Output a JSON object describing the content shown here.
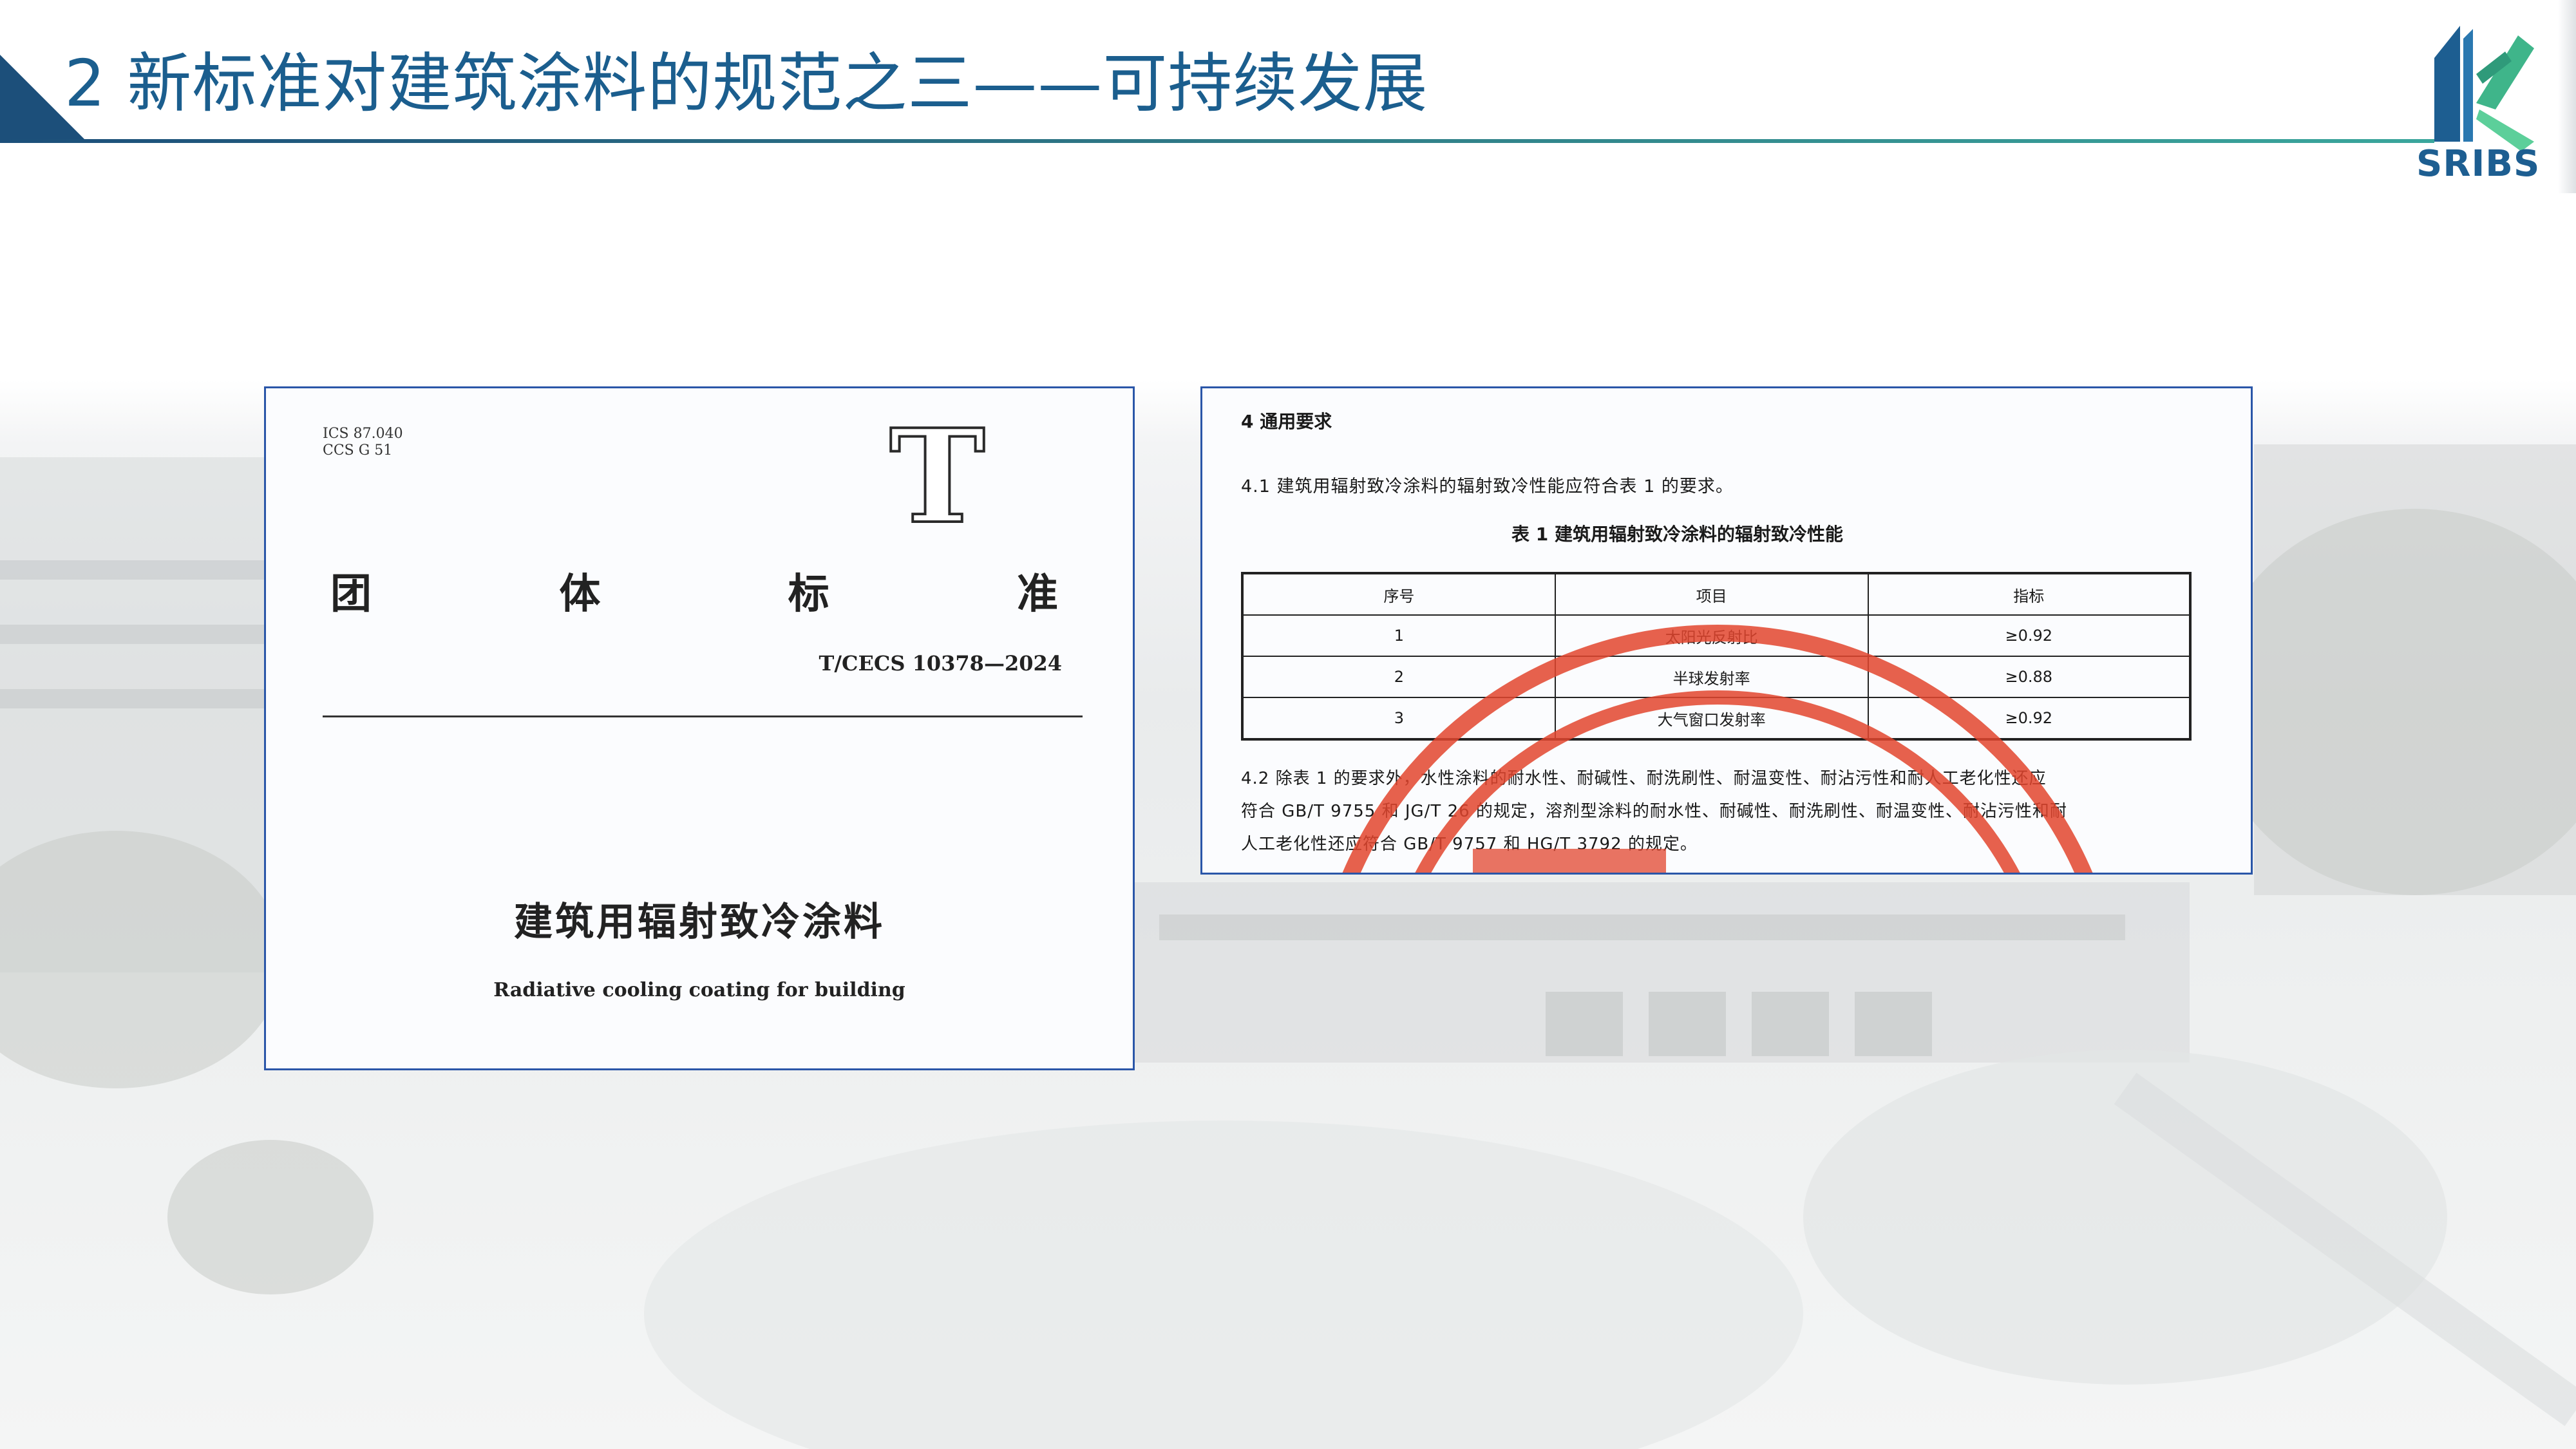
{
  "header": {
    "title": "2 新标准对建筑涂料的规范之三——可持续发展",
    "logo_text": "SRIBS"
  },
  "cover": {
    "ics": "ICS 87.040",
    "ccs": "CCS G 51",
    "category_letter": "T",
    "standard_type_chars": [
      "团",
      "体",
      "标",
      "准"
    ],
    "standard_number": "T/CECS 10378—2024",
    "title_cn": "建筑用辐射致冷涂料",
    "title_en": "Radiative cooling coating for building"
  },
  "requirements": {
    "section_heading": "4   通用要求",
    "clause_4_1": "4.1   建筑用辐射致冷涂料的辐射致冷性能应符合表 1 的要求。",
    "table_caption": "表 1   建筑用辐射致冷涂料的辐射致冷性能",
    "table_headers": [
      "序号",
      "项目",
      "指标"
    ],
    "table_rows": [
      [
        "1",
        "太阳光反射比",
        "≥0.92"
      ],
      [
        "2",
        "半球发射率",
        "≥0.88"
      ],
      [
        "3",
        "大气窗口发射率",
        "≥0.92"
      ]
    ],
    "clause_4_2_line1": "4.2   除表 1 的要求外，水性涂料的耐水性、耐碱性、耐洗刷性、耐温变性、耐沾污性和耐人工老化性还应",
    "clause_4_2_line2": "符合 GB/T 9755 和 JG/T 26 的规定，溶剂型涂料的耐水性、耐碱性、耐洗刷性、耐温变性、耐沾污性和耐",
    "clause_4_2_line3": "人工老化性还应符合 GB/T 9757 和 HG/T 3792 的规定。"
  },
  "colors": {
    "title_blue": "#1b5e8e",
    "frame_blue": "#2a56a8",
    "stamp_red": "#e2452e",
    "logo_green": "#3fb58a"
  }
}
